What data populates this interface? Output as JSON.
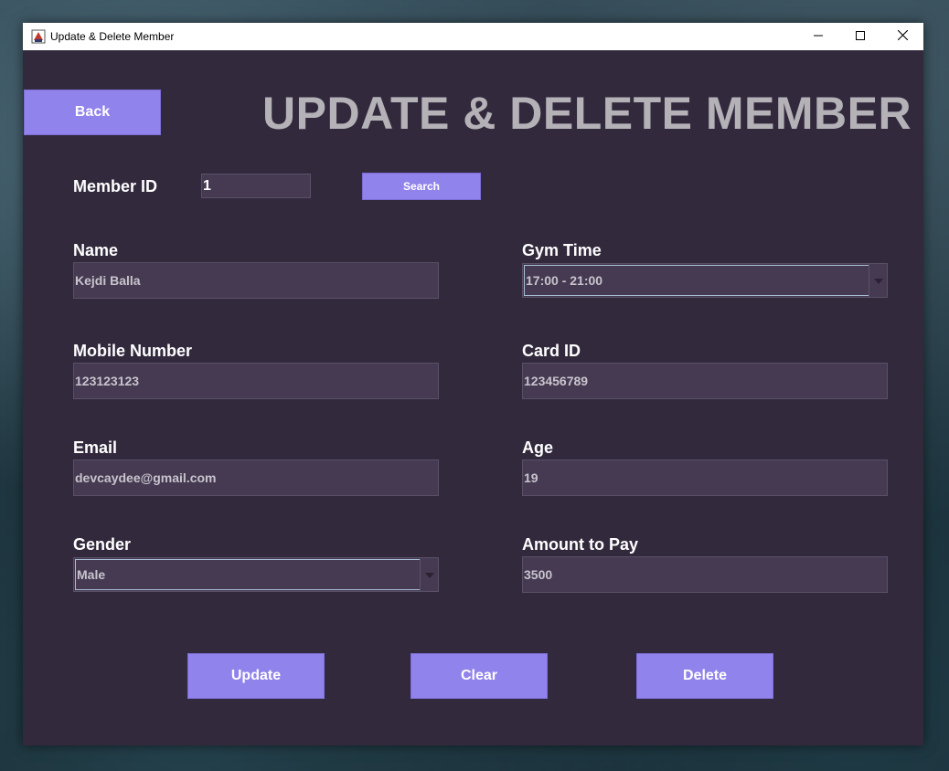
{
  "window": {
    "title": "Update & Delete Member",
    "icon": "java-cup-icon",
    "controls": {
      "minimize": "minimize-icon",
      "maximize": "maximize-icon",
      "close": "close-icon"
    }
  },
  "header": {
    "back_label": "Back",
    "title": "UPDATE & DELETE MEMBER"
  },
  "search": {
    "label": "Member ID",
    "value": "1",
    "button_label": "Search"
  },
  "form": {
    "name": {
      "label": "Name",
      "value": "Kejdi Balla"
    },
    "gym_time": {
      "label": "Gym Time",
      "value": "17:00 - 21:00"
    },
    "mobile": {
      "label": "Mobile Number",
      "value": "123123123"
    },
    "card_id": {
      "label": "Card ID",
      "value": "123456789"
    },
    "email": {
      "label": "Email",
      "value": "devcaydee@gmail.com"
    },
    "age": {
      "label": "Age",
      "value": "19"
    },
    "gender": {
      "label": "Gender",
      "value": "Male"
    },
    "amount": {
      "label": "Amount to Pay",
      "value": "3500"
    }
  },
  "actions": {
    "update": "Update",
    "clear": "Clear",
    "delete": "Delete"
  },
  "colors": {
    "panel_bg": "#32293d",
    "accent": "#9183ec",
    "field_bg": "#453a52",
    "heading": "#b4b1b7"
  }
}
